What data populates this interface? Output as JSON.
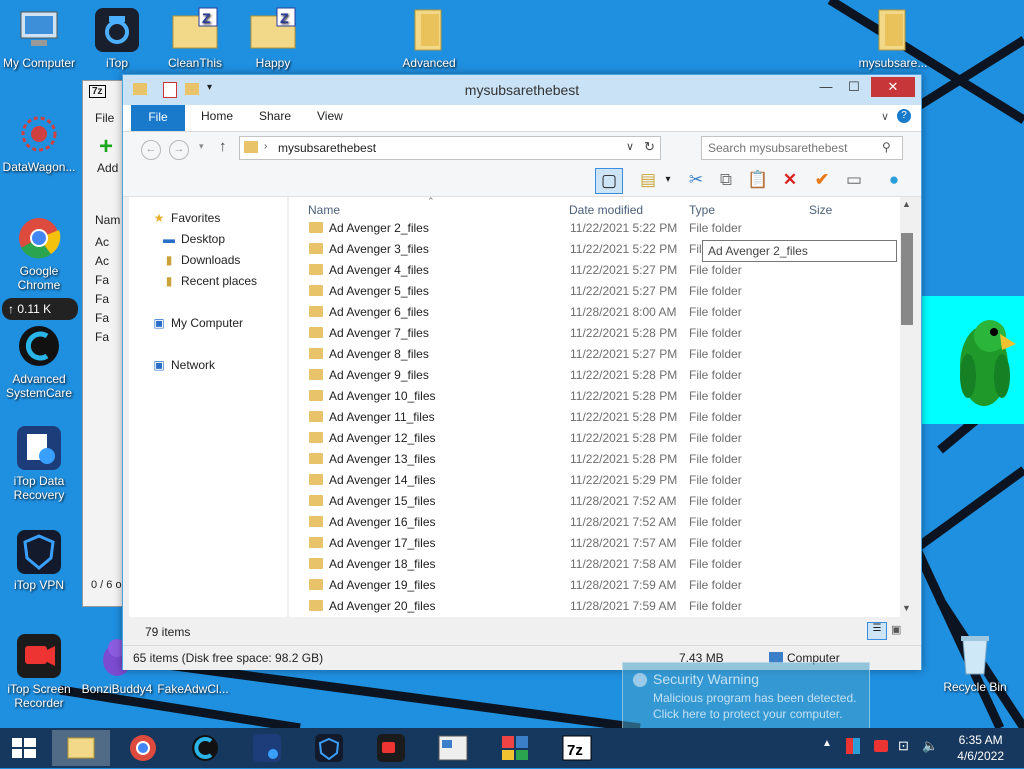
{
  "desktop_icons": [
    {
      "label": "My Computer"
    },
    {
      "label": "iTop"
    },
    {
      "label": "CleanThis"
    },
    {
      "label": "Happy"
    },
    {
      "label": "Advanced"
    },
    {
      "label": "mysubsare..."
    },
    {
      "label": "DataWagon..."
    },
    {
      "label": "Google Chrome"
    },
    {
      "label": "Advanced SystemCare"
    },
    {
      "label": "iTop Data Recovery"
    },
    {
      "label": "iTop VPN"
    },
    {
      "label": "iTop Screen Recorder"
    },
    {
      "label": "BonziBuddy4"
    },
    {
      "label": "FakeAdwCl..."
    },
    {
      "label": "Recycle Bin"
    }
  ],
  "net_speed": "↑ 0.11 K",
  "zip_window": {
    "title_icon": "7z",
    "menu_file": "File",
    "add_label": "Add",
    "col_name": "Nam",
    "rows": [
      "Ac",
      "Ac",
      "Fa",
      "Fa",
      "Fa",
      "Fa"
    ],
    "status": "0 / 6 o"
  },
  "explorer": {
    "title": "mysubsarethebest",
    "tabs": [
      "File",
      "Home",
      "Share",
      "View"
    ],
    "address": "mysubsarethebest",
    "search_placeholder": "Search mysubsarethebest",
    "nav": {
      "favorites": "Favorites",
      "desktop": "Desktop",
      "downloads": "Downloads",
      "recent": "Recent places",
      "computer": "My Computer",
      "network": "Network"
    },
    "columns": {
      "name": "Name",
      "date": "Date modified",
      "type": "Type",
      "size": "Size"
    },
    "files": [
      {
        "name": "Ad Avenger 2_files",
        "date": "11/22/2021 5:22 PM",
        "type": "File folder"
      },
      {
        "name": "Ad Avenger 3_files",
        "date": "11/22/2021 5:22 PM",
        "type": "File"
      },
      {
        "name": "Ad Avenger 4_files",
        "date": "11/22/2021 5:27 PM",
        "type": "File folder"
      },
      {
        "name": "Ad Avenger 5_files",
        "date": "11/22/2021 5:27 PM",
        "type": "File folder"
      },
      {
        "name": "Ad Avenger 6_files",
        "date": "11/28/2021 8:00 AM",
        "type": "File folder"
      },
      {
        "name": "Ad Avenger 7_files",
        "date": "11/22/2021 5:28 PM",
        "type": "File folder"
      },
      {
        "name": "Ad Avenger 8_files",
        "date": "11/22/2021 5:27 PM",
        "type": "File folder"
      },
      {
        "name": "Ad Avenger 9_files",
        "date": "11/22/2021 5:28 PM",
        "type": "File folder"
      },
      {
        "name": "Ad Avenger 10_files",
        "date": "11/22/2021 5:28 PM",
        "type": "File folder"
      },
      {
        "name": "Ad Avenger 11_files",
        "date": "11/22/2021 5:28 PM",
        "type": "File folder"
      },
      {
        "name": "Ad Avenger 12_files",
        "date": "11/22/2021 5:28 PM",
        "type": "File folder"
      },
      {
        "name": "Ad Avenger 13_files",
        "date": "11/22/2021 5:28 PM",
        "type": "File folder"
      },
      {
        "name": "Ad Avenger 14_files",
        "date": "11/22/2021 5:29 PM",
        "type": "File folder"
      },
      {
        "name": "Ad Avenger 15_files",
        "date": "11/28/2021 7:52 AM",
        "type": "File folder"
      },
      {
        "name": "Ad Avenger 16_files",
        "date": "11/28/2021 7:52 AM",
        "type": "File folder"
      },
      {
        "name": "Ad Avenger 17_files",
        "date": "11/28/2021 7:57 AM",
        "type": "File folder"
      },
      {
        "name": "Ad Avenger 18_files",
        "date": "11/28/2021 7:58 AM",
        "type": "File folder"
      },
      {
        "name": "Ad Avenger 19_files",
        "date": "11/28/2021 7:59 AM",
        "type": "File folder"
      },
      {
        "name": "Ad Avenger 20_files",
        "date": "11/28/2021 7:59 AM",
        "type": "File folder"
      }
    ],
    "tooltip": "Ad Avenger 2_files",
    "item_count": "79 items",
    "details_left": "65 items (Disk free space: 98.2 GB)",
    "details_size": "7.43 MB",
    "details_location": "Computer"
  },
  "toast": {
    "title": "Security Warning",
    "line1": "Malicious program has been detected.",
    "line2": "Click here to protect your computer."
  },
  "clock": {
    "time": "6:35 AM",
    "date": "4/6/2022"
  },
  "colors": {
    "accent": "#1979ca",
    "close": "#c7373a",
    "taskbar": "#17385e",
    "desktop": "#1f8fe0"
  }
}
